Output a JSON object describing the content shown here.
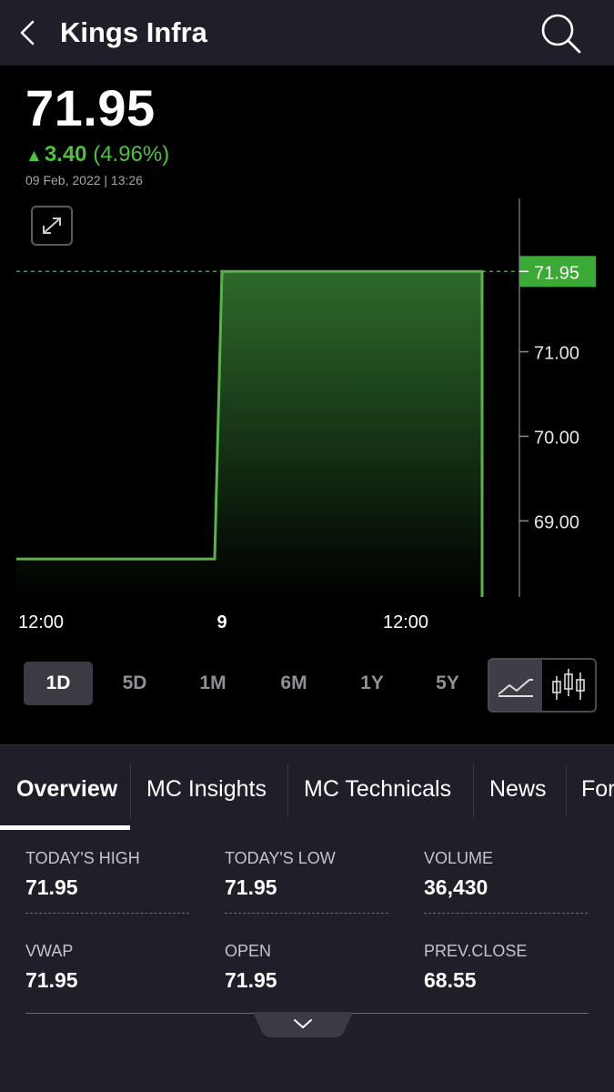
{
  "header": {
    "title": "Kings Infra"
  },
  "quote": {
    "price": "71.95",
    "change_abs": "3.40",
    "change_pct": "(4.96%)",
    "timestamp": "09 Feb, 2022 | 13:26"
  },
  "chart_data": {
    "type": "area",
    "x_tick_labels": [
      "12:00",
      "9",
      "12:00"
    ],
    "y_tick_labels": [
      "71.00",
      "70.00",
      "69.00"
    ],
    "current_price_label": "71.95",
    "x": [
      "12:00",
      "9",
      "12:00"
    ],
    "y": [
      68.55,
      71.95,
      71.95
    ],
    "ylim": [
      68.1,
      72.9
    ],
    "grid": false,
    "colors": {
      "line": "#59b34a",
      "fill_top": "#2d6a2a",
      "fill_bottom": "#000000",
      "price_tag": "#3aa935"
    }
  },
  "ranges": {
    "items": [
      "1D",
      "5D",
      "1M",
      "6M",
      "1Y",
      "5Y"
    ],
    "active": "1D"
  },
  "tabs": {
    "items": [
      "Overview",
      "MC Insights",
      "MC Technicals",
      "News",
      "For"
    ],
    "active": "Overview"
  },
  "stats": {
    "todays_high": {
      "label": "TODAY'S HIGH",
      "value": "71.95"
    },
    "todays_low": {
      "label": "TODAY'S LOW",
      "value": "71.95"
    },
    "volume": {
      "label": "VOLUME",
      "value": "36,430"
    },
    "vwap": {
      "label": "VWAP",
      "value": "71.95"
    },
    "open": {
      "label": "OPEN",
      "value": "71.95"
    },
    "prev_close": {
      "label": "PREV.CLOSE",
      "value": "68.55"
    }
  },
  "icons": {
    "back": "back-arrow-icon",
    "search": "search-icon",
    "expand": "expand-icon",
    "line_chart": "line-chart-icon",
    "candle_chart": "candlestick-icon",
    "chevron": "chevron-down-icon"
  },
  "colors": {
    "positive": "#4cc23d",
    "header_bg": "#1f1f29",
    "active_tab_bg": "#3b3b44"
  }
}
